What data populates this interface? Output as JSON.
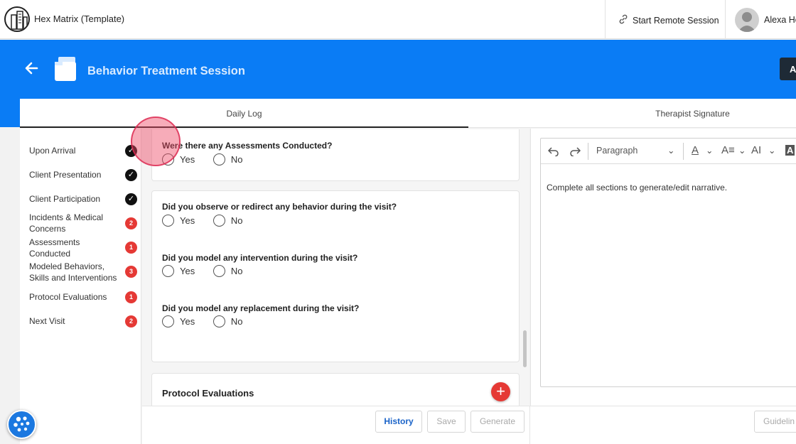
{
  "app": {
    "title": "Hex Matrix (Template)"
  },
  "header": {
    "remote_label": "Start Remote Session",
    "user_name": "Alexa He"
  },
  "page": {
    "title": "Behavior Treatment Session",
    "right_button": "A"
  },
  "tabs": [
    {
      "label": "Daily Log"
    },
    {
      "label": "Therapist Signature"
    }
  ],
  "sidebar": {
    "items": [
      {
        "label": "Upon Arrival",
        "status": "check"
      },
      {
        "label": "Client Presentation",
        "status": "check"
      },
      {
        "label": "Client Participation",
        "status": "check"
      },
      {
        "label": "Incidents & Medical Concerns",
        "badge": "2"
      },
      {
        "label": "Assessments Conducted",
        "badge": "1"
      },
      {
        "label": "Modeled Behaviors, Skills and Interventions",
        "badge": "3"
      },
      {
        "label": "Protocol Evaluations",
        "badge": "1"
      },
      {
        "label": "Next Visit",
        "badge": "2"
      }
    ]
  },
  "questions": {
    "assessments": "Were there any Assessments Conducted?",
    "observe": "Did you observe or redirect any behavior during the visit?",
    "intervention": "Did you model any intervention during the visit?",
    "replacement": "Did you model any replacement during the visit?",
    "yes": "Yes",
    "no": "No"
  },
  "protocol": {
    "title": "Protocol Evaluations"
  },
  "editor": {
    "format": "Paragraph",
    "placeholder_text": "Complete all sections to generate/edit narrative."
  },
  "actions": {
    "history": "History",
    "save": "Save",
    "generate": "Generate",
    "guidelines": "Guidelin"
  },
  "colors": {
    "brand_blue": "#0a7cf5",
    "badge_red": "#e53935",
    "link_blue": "#1a63c8"
  }
}
